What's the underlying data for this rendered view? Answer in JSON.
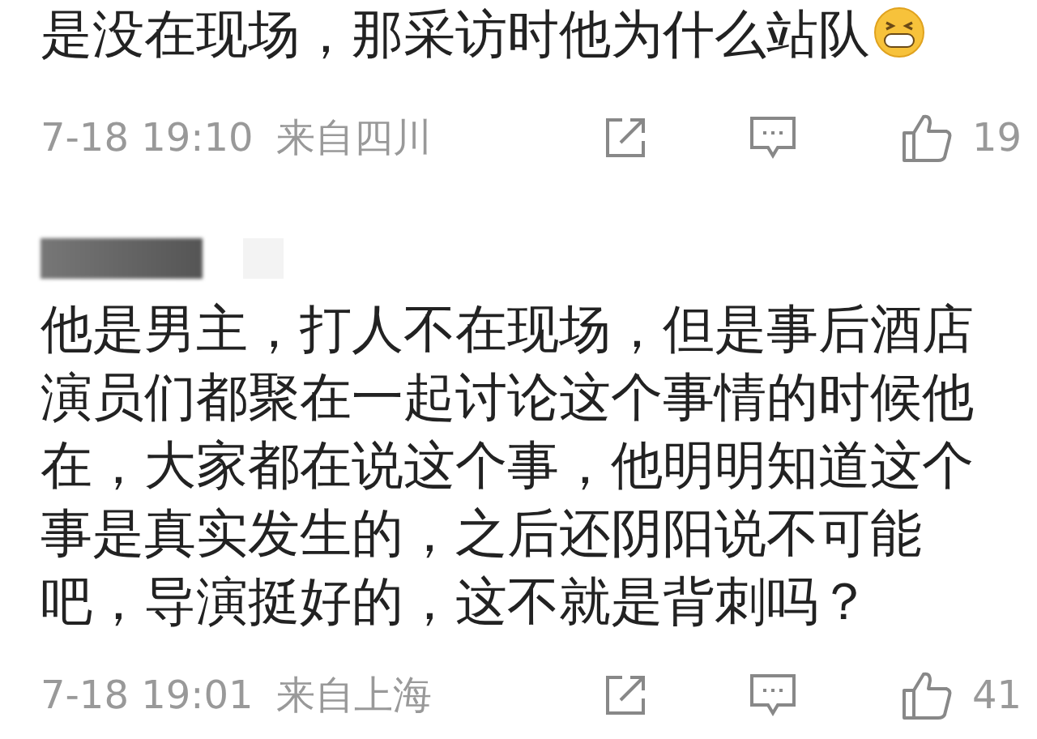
{
  "comments": [
    {
      "text": "是没在现场，那采访时他为什么站队",
      "emoji": true,
      "redacted_author": false,
      "time": "7-18 19:10",
      "location": "来自四川",
      "likes": "19"
    },
    {
      "text": "他是男主，打人不在现场，但是事后酒店演员们都聚在一起讨论这个事情的时候他在，大家都在说这个事，他明明知道这个事是真实发生的，之后还阴阳说不可能吧，导演挺好的，这不就是背刺吗？",
      "emoji": false,
      "redacted_author": true,
      "time": "7-18 19:01",
      "location": "来自上海",
      "likes": "41"
    }
  ]
}
